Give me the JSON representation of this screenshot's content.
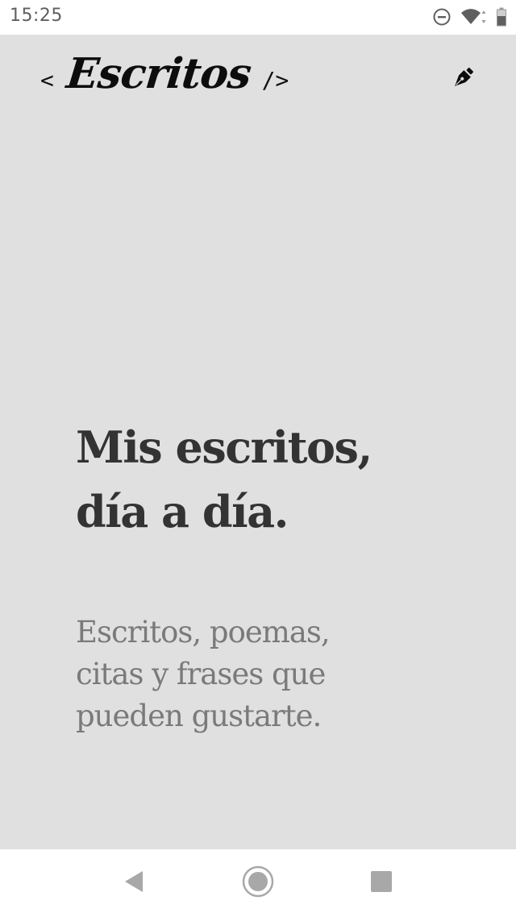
{
  "status_bar": {
    "time": "15:25",
    "icons": [
      "do-not-disturb-icon",
      "wifi-icon",
      "battery-icon"
    ]
  },
  "header": {
    "brand_open": "<",
    "brand_name": "Escritos",
    "brand_close": "/>",
    "write_icon": "pen-nib-icon"
  },
  "hero": {
    "title_line1": "Mis escritos,",
    "title_line2": "día a día.",
    "subtitle_line1": "Escritos, poemas,",
    "subtitle_line2": "citas y frases que",
    "subtitle_line3": "pueden gustarte."
  },
  "nav_bar": {
    "icons": [
      "back-icon",
      "home-icon",
      "recents-icon"
    ]
  },
  "colors": {
    "app_background": "#e0e0e0",
    "title_text": "#333333",
    "subtitle_text": "#7a7a7a",
    "brand_text": "#111111"
  }
}
